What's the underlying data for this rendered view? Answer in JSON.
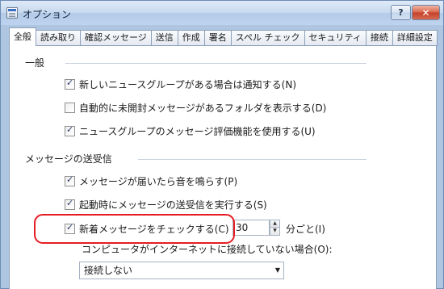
{
  "window": {
    "title": "オプション",
    "help_label": "?",
    "close_label": "✕"
  },
  "tabs": [
    {
      "label": "全般",
      "active": true
    },
    {
      "label": "読み取り"
    },
    {
      "label": "確認メッセージ"
    },
    {
      "label": "送信"
    },
    {
      "label": "作成"
    },
    {
      "label": "署名"
    },
    {
      "label": "スペル チェック"
    },
    {
      "label": "セキュリティ"
    },
    {
      "label": "接続"
    },
    {
      "label": "詳細設定"
    }
  ],
  "general": {
    "heading": "一般",
    "items": [
      {
        "label": "新しいニュースグループがある場合は通知する(N)",
        "checked": true
      },
      {
        "label": "自動的に未開封メッセージがあるフォルダを表示する(D)",
        "checked": false
      },
      {
        "label": "ニュースグループのメッセージ評価機能を使用する(U)",
        "checked": true
      }
    ]
  },
  "send_receive": {
    "heading": "メッセージの送受信",
    "items": [
      {
        "label": "メッセージが届いたら音を鳴らす(P)",
        "checked": true
      },
      {
        "label": "起動時にメッセージの送受信を実行する(S)",
        "checked": true
      },
      {
        "label": "新着メッセージをチェックする(C)",
        "checked": true
      }
    ],
    "interval_value": "30",
    "interval_unit": "分ごと(I)",
    "offline_label": "コンピュータがインターネットに接続していない場合(O):",
    "offline_value": "接続しない"
  },
  "colors": {
    "highlight": "#e51c23",
    "check": "#2a3a68"
  }
}
